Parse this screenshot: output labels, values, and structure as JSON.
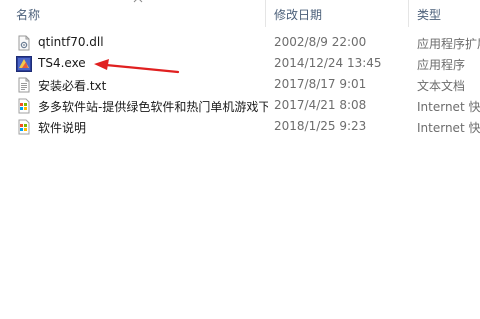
{
  "columns": {
    "name": "名称",
    "date": "修改日期",
    "type": "类型"
  },
  "files": [
    {
      "icon": "dll-file-icon",
      "name": "qtintf70.dll",
      "date": "2002/8/9 22:00",
      "type": "应用程序扩展"
    },
    {
      "icon": "exe-app-icon",
      "name": "TS4.exe",
      "date": "2014/12/24 13:45",
      "type": "应用程序"
    },
    {
      "icon": "text-file-icon",
      "name": "安装必看.txt",
      "date": "2017/8/17 9:01",
      "type": "文本文档"
    },
    {
      "icon": "internet-shortcut-icon",
      "name": "多多软件站-提供绿色软件和热门单机游戏下载",
      "date": "2017/4/21 8:08",
      "type": "Internet 快捷方式"
    },
    {
      "icon": "internet-shortcut-icon",
      "name": "软件说明",
      "date": "2018/1/25 9:23",
      "type": "Internet 快捷方式"
    }
  ],
  "annotation": {
    "color": "#e02020",
    "points_to": "TS4.exe"
  }
}
